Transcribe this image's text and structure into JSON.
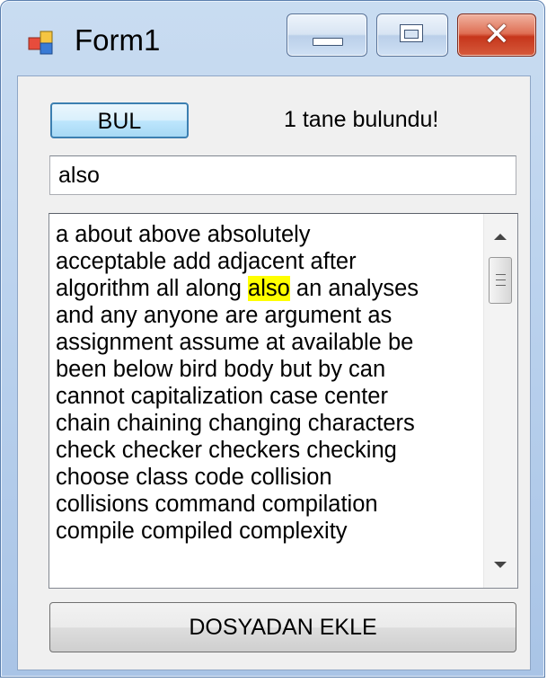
{
  "window": {
    "title": "Form1",
    "close_glyph": "✕"
  },
  "search": {
    "button_label": "BUL",
    "result_text": "1 tane bulundu!",
    "input_value": "also"
  },
  "content": {
    "before": "a about above absolutely\nacceptable add adjacent after\nalgorithm all along ",
    "highlight": "also",
    "after": " an analyses\nand any anyone are argument as\nassignment assume at available be\nbeen below bird body but by can\ncannot capitalization case center\nchain chaining changing characters\ncheck checker checkers checking\nchoose class code collision\ncollisions command compilation\ncompile compiled complexity",
    "highlight_color": "#ffff00"
  },
  "footer": {
    "add_button_label": "DOSYADAN EKLE"
  },
  "icons": {
    "app": "form-app-icon",
    "minimize": "minimize-icon",
    "maximize": "maximize-icon",
    "close": "close-icon"
  },
  "colors": {
    "titlebar": "#bcd3ee",
    "client": "#f0f0f0",
    "close_button": "#c6361b",
    "focused_button_border": "#3c7fb1"
  }
}
